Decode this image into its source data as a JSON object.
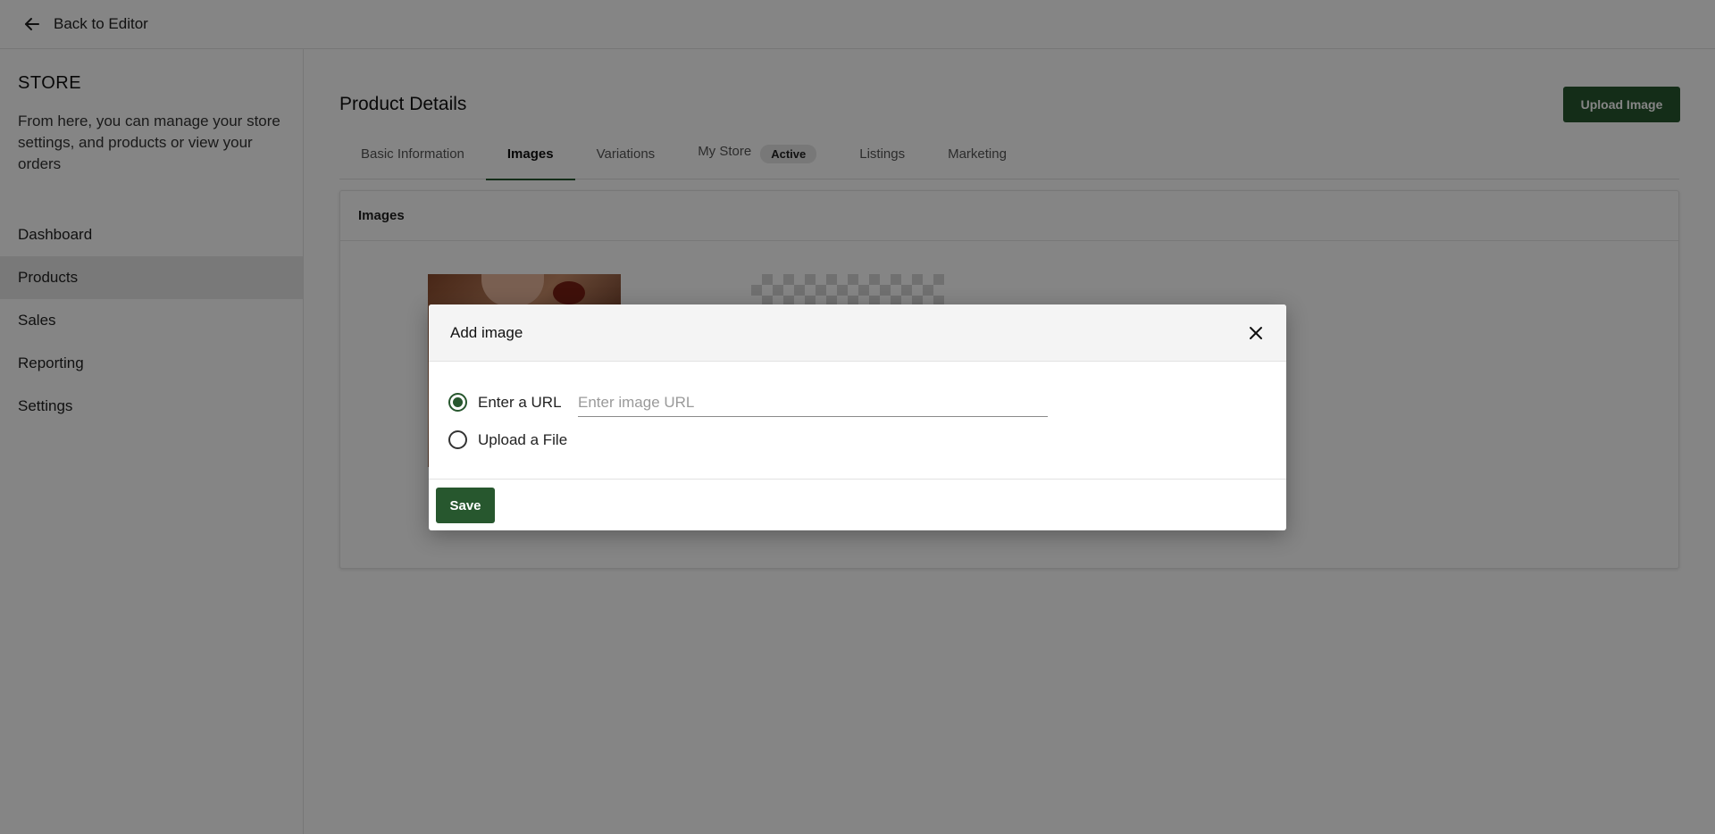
{
  "topbar": {
    "back_label": "Back to Editor",
    "back_icon": "arrow-left-icon"
  },
  "sidebar": {
    "title": "STORE",
    "description": "From here, you can manage your store settings, and products or view your orders",
    "items": [
      {
        "label": "Dashboard",
        "active": false
      },
      {
        "label": "Products",
        "active": true
      },
      {
        "label": "Sales",
        "active": false
      },
      {
        "label": "Reporting",
        "active": false
      },
      {
        "label": "Settings",
        "active": false
      }
    ]
  },
  "main": {
    "title": "Product Details",
    "upload_label": "Upload Image",
    "tabs": [
      {
        "label": "Basic Information"
      },
      {
        "label": "Images",
        "active": true
      },
      {
        "label": "Variations"
      },
      {
        "label": "My Store",
        "badge": "Active"
      },
      {
        "label": "Listings"
      },
      {
        "label": "Marketing"
      }
    ],
    "card_title": "Images"
  },
  "modal": {
    "title": "Add image",
    "close_icon": "close-icon",
    "option_url": "Enter a URL",
    "option_file": "Upload a File",
    "url_value": "",
    "url_placeholder": "Enter image URL",
    "selected": "url",
    "save_label": "Save"
  },
  "colors": {
    "brand_green": "#27572e",
    "overlay": "rgba(0,0,0,0.48)"
  }
}
